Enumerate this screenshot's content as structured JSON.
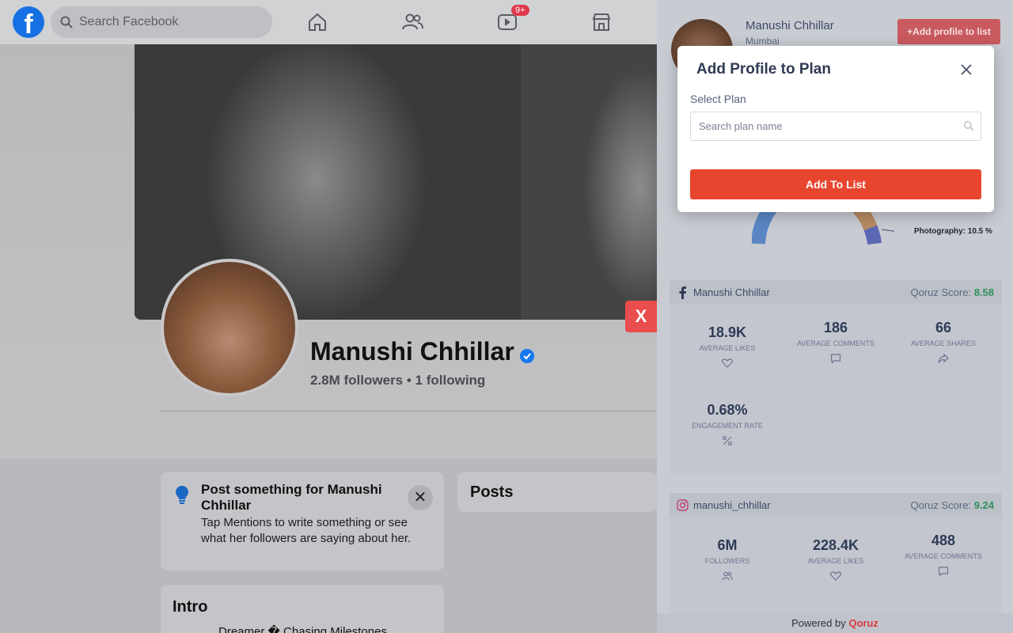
{
  "facebook": {
    "search": {
      "placeholder": "Search Facebook"
    },
    "nav": {
      "watch_badge": "9+"
    },
    "profile": {
      "name": "Manushi Chhillar",
      "stats": "2.8M followers • 1 following"
    },
    "post_prompt": {
      "title": "Post something for Manushi Chhillar",
      "description": "Tap Mentions to write something or see what her followers are saying about her."
    },
    "posts_heading": "Posts",
    "intro": {
      "heading": "Intro",
      "bio": "Dreamer � Chasing Milestones"
    },
    "close_overlay_label": "X"
  },
  "qoruz": {
    "profile": {
      "name": "Manushi Chhillar",
      "city": "Mumbai",
      "add_button": "+Add profile to list"
    },
    "chart": {
      "label": "Photography: 10.5 %"
    },
    "facebook_card": {
      "handle": "Manushi Chhillar",
      "score_label": "Qoruz Score:",
      "score": "8.58",
      "metrics": [
        {
          "value": "18.9K",
          "label": "AVERAGE LIKES",
          "icon": "heart-icon"
        },
        {
          "value": "186",
          "label": "AVERAGE COMMENTS",
          "icon": "comment-icon"
        },
        {
          "value": "66",
          "label": "AVERAGE SHARES",
          "icon": "share-icon"
        },
        {
          "value": "0.68%",
          "label": "ENGAGEMENT RATE",
          "icon": "percent-icon"
        }
      ]
    },
    "instagram_card": {
      "handle": "manushi_chhillar",
      "score_label": "Qoruz Score:",
      "score": "9.24",
      "metrics": [
        {
          "value": "6M",
          "label": "FOLLOWERS",
          "icon": "users-icon"
        },
        {
          "value": "228.4K",
          "label": "AVERAGE LIKES",
          "icon": "heart-icon"
        },
        {
          "value": "488",
          "label": "AVERAGE COMMENTS",
          "icon": "comment-icon"
        }
      ]
    },
    "footer": {
      "prefix": "Powered by",
      "brand": "Qoruz"
    }
  },
  "modal": {
    "title": "Add Profile to Plan",
    "select_label": "Select Plan",
    "search_placeholder": "Search plan name",
    "submit_label": "Add To List"
  },
  "colors": {
    "facebook_blue": "#1877f2",
    "qoruz_red": "#e8452f",
    "score_green": "#2f8f5a"
  }
}
